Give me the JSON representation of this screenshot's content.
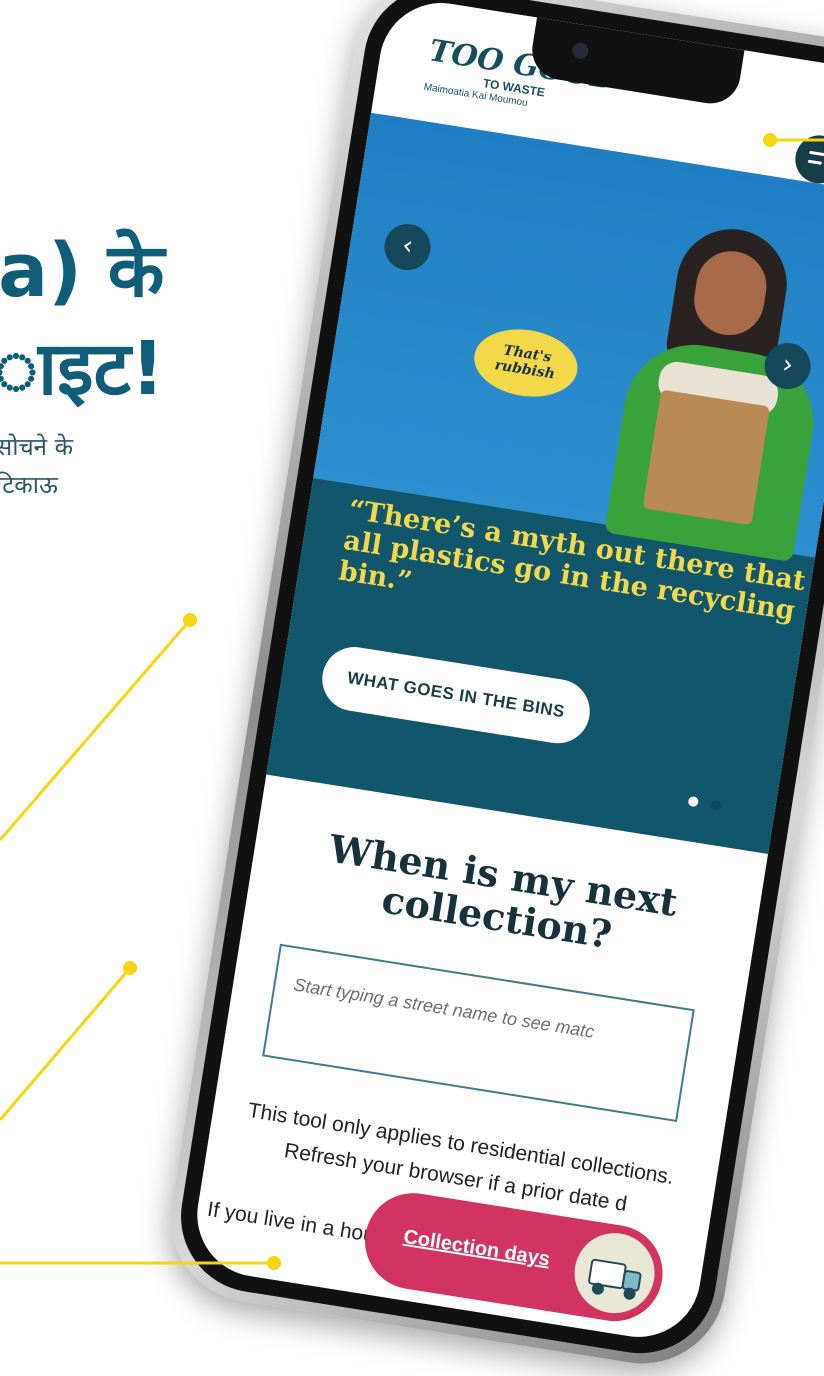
{
  "promo": {
    "title_line1": "a) के",
    "title_line2": "ाइट!",
    "sub_line1": "सोचने के",
    "sub_line2": "टिकाऊ"
  },
  "app": {
    "logo_line1": "TOO GOOD",
    "logo_line2": "TO WASTE",
    "logo_line3": "Maimoatia Kai Moumou",
    "menu_icon": "menu-icon"
  },
  "hero": {
    "speech_bubble": "That's rubbish",
    "quote": "“There’s a myth out there that all plastics go in the recycling bin.”",
    "cta_label": "WHAT GOES IN THE BINS",
    "prev_icon": "chevron-left-icon",
    "next_icon": "chevron-right-icon",
    "slide_count": 2,
    "active_slide": 1
  },
  "collection": {
    "title": "When is my next collection?",
    "search_placeholder": "Start typing a street name to see matc",
    "note": "This tool only applies to residential collections. Refresh your browser if a prior date d",
    "note2": "If you live in a house",
    "pill_label": "Collection days"
  },
  "colors": {
    "brand": "#11566a",
    "accent_yellow": "#f2d94b",
    "annotation": "#f5d60f",
    "pill": "#d23461"
  }
}
